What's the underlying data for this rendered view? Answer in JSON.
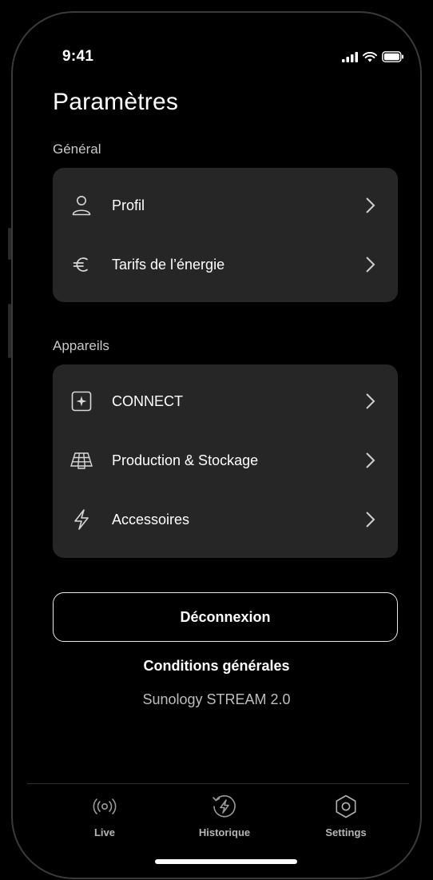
{
  "status_bar": {
    "time": "9:41"
  },
  "page_title": "Paramètres",
  "sections": [
    {
      "label": "Général",
      "items": [
        {
          "label": "Profil",
          "icon": "person-icon"
        },
        {
          "label": "Tarifs de l’énergie",
          "icon": "euro-icon"
        }
      ]
    },
    {
      "label": "Appareils",
      "items": [
        {
          "label": "CONNECT",
          "icon": "connect-device-icon"
        },
        {
          "label": "Production & Stockage",
          "icon": "solar-panel-icon"
        },
        {
          "label": "Accessoires",
          "icon": "lightning-icon"
        }
      ]
    }
  ],
  "logout_label": "Déconnexion",
  "terms_label": "Conditions générales",
  "version_label": "Sunology STREAM 2.0",
  "tabs": [
    {
      "label": "Live",
      "icon": "broadcast-icon"
    },
    {
      "label": "Historique",
      "icon": "history-bolt-icon"
    },
    {
      "label": "Settings",
      "icon": "gear-icon"
    }
  ],
  "colors": {
    "background": "#000000",
    "card": "#262626",
    "text": "#ffffff",
    "muted": "#bdbdbd"
  }
}
